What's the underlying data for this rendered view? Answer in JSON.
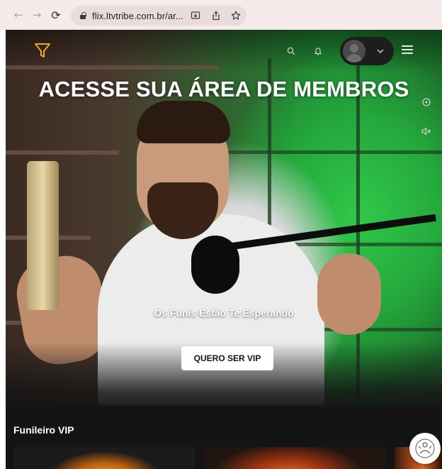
{
  "browser": {
    "url": "flix.ltvtribe.com.br/ar...",
    "icons": {
      "back": "arrow-left-icon",
      "forward": "arrow-right-icon",
      "reload": "reload-icon",
      "lock": "lock-icon",
      "install": "install-app-icon",
      "share": "share-icon",
      "bookmark": "star-icon"
    }
  },
  "site_header": {
    "logo_icon": "funnel-logo-icon",
    "search_icon": "search-icon",
    "notifications_icon": "bell-icon",
    "avatar_icon": "user-avatar-icon",
    "chevron_icon": "chevron-down-icon",
    "menu_icon": "hamburger-menu-icon",
    "accent_color": "#f5a623"
  },
  "hero": {
    "title": "ACESSE SUA ÁREA DE MEMBROS",
    "tagline": "Os Funis Estão Te Esperando",
    "cta_label": "QUERO SER VIP",
    "side_icons": [
      "info-icon",
      "mute-icon"
    ]
  },
  "section": {
    "title": "Funileiro VIP",
    "cards": [
      "card-1",
      "card-2",
      "card-3"
    ]
  },
  "chat_widget": {
    "icon": "support-chat-icon"
  }
}
